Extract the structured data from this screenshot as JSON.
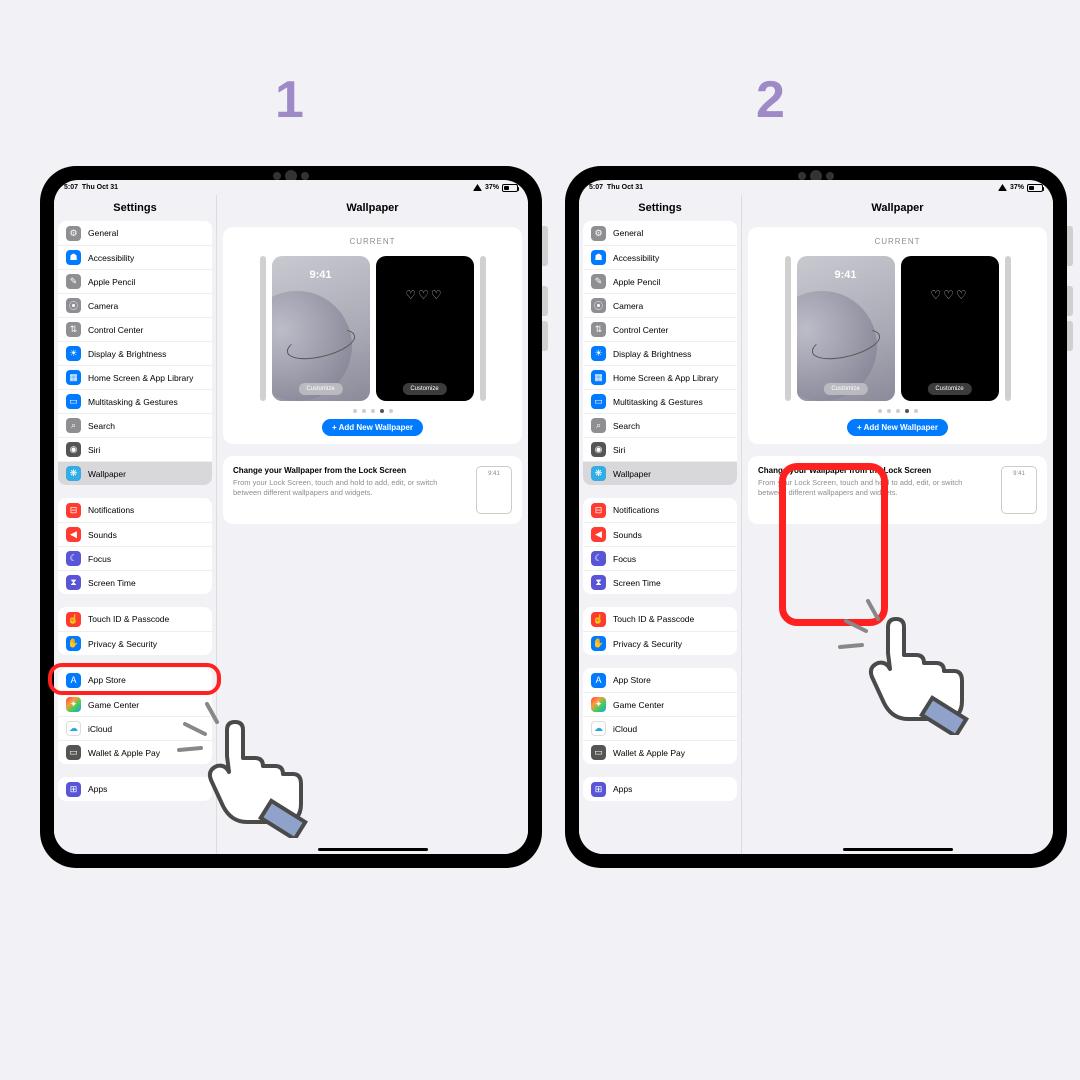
{
  "steps": {
    "one": "1",
    "two": "2"
  },
  "status": {
    "time": "5:07",
    "date": "Thu Oct 31",
    "battery_pct": "37%"
  },
  "sidebar": {
    "title": "Settings",
    "groups": [
      [
        {
          "label": "General",
          "icon": "gear",
          "color": "gray"
        },
        {
          "label": "Accessibility",
          "icon": "figure",
          "color": "blue"
        },
        {
          "label": "Apple Pencil",
          "icon": "pencil",
          "color": "gray"
        },
        {
          "label": "Camera",
          "icon": "camera",
          "color": "gray"
        },
        {
          "label": "Control Center",
          "icon": "switches",
          "color": "gray"
        },
        {
          "label": "Display & Brightness",
          "icon": "sun",
          "color": "blue"
        },
        {
          "label": "Home Screen & App Library",
          "icon": "grid",
          "color": "blue"
        },
        {
          "label": "Multitasking & Gestures",
          "icon": "rects",
          "color": "blue"
        },
        {
          "label": "Search",
          "icon": "search",
          "color": "gray"
        },
        {
          "label": "Siri",
          "icon": "siri",
          "color": "dkgray"
        },
        {
          "label": "Wallpaper",
          "icon": "flower",
          "color": "cyan",
          "selected": true
        }
      ],
      [
        {
          "label": "Notifications",
          "icon": "bell",
          "color": "red"
        },
        {
          "label": "Sounds",
          "icon": "speaker",
          "color": "red"
        },
        {
          "label": "Focus",
          "icon": "moon",
          "color": "purple"
        },
        {
          "label": "Screen Time",
          "icon": "hourglass",
          "color": "purple"
        }
      ],
      [
        {
          "label": "Touch ID & Passcode",
          "icon": "finger",
          "color": "red"
        },
        {
          "label": "Privacy & Security",
          "icon": "hand",
          "color": "blue"
        }
      ],
      [
        {
          "label": "App Store",
          "icon": "appstore",
          "color": "blue"
        },
        {
          "label": "Game Center",
          "icon": "game",
          "color": "multi"
        },
        {
          "label": "iCloud",
          "icon": "cloud",
          "color": "white"
        },
        {
          "label": "Wallet & Apple Pay",
          "icon": "wallet",
          "color": "dkgray"
        }
      ],
      [
        {
          "label": "Apps",
          "icon": "apps",
          "color": "purple"
        }
      ]
    ]
  },
  "content": {
    "title": "Wallpaper",
    "current_label": "CURRENT",
    "preview_time": "9:41",
    "customize_label": "Customize",
    "pager_count": 5,
    "pager_active": 3,
    "add_button": "+ Add New Wallpaper",
    "hint_title": "Change your Wallpaper from the Lock Screen",
    "hint_body": "From your Lock Screen, touch and hold to add, edit, or switch between different wallpapers and widgets.",
    "hint_mini_time": "9:41"
  },
  "icons": {
    "gear": "⚙",
    "figure": "☗",
    "pencil": "✎",
    "camera": "⦿",
    "switches": "⇅",
    "sun": "☀",
    "grid": "▦",
    "rects": "▭",
    "search": "⌕",
    "siri": "◉",
    "flower": "❋",
    "bell": "⊟",
    "speaker": "◀",
    "moon": "☾",
    "hourglass": "⧗",
    "finger": "☝",
    "hand": "✋",
    "appstore": "A",
    "game": "✦",
    "cloud": "☁",
    "wallet": "▭",
    "apps": "⊞"
  }
}
